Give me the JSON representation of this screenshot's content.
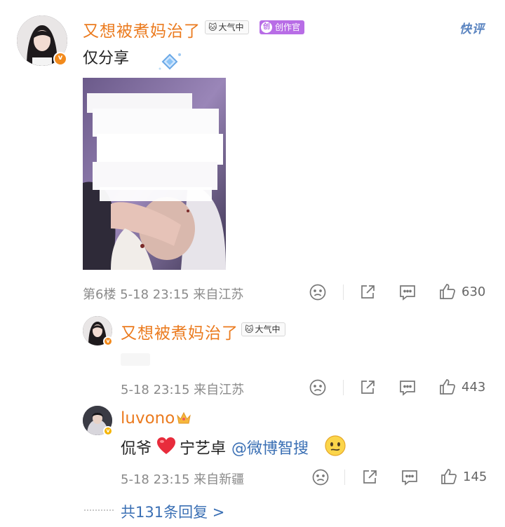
{
  "main_comment": {
    "username": "又想被煮妈治了",
    "tag_label": "大气中",
    "creator_label": "创作官",
    "quick_label": "快评",
    "text": "仅分享",
    "meta": "第6楼 5-18 23:15 来自江苏",
    "likes": "630"
  },
  "replies": [
    {
      "username": "又想被煮妈治了",
      "tag_label": "大气中",
      "meta": "5-18 23:15 来自江苏",
      "likes": "443"
    },
    {
      "username": "luvono",
      "text_prefix": "侃爷",
      "text_middle": "宁艺卓",
      "mention": "@微博智搜",
      "meta": "5-18 23:15 来自新疆",
      "likes": "145"
    }
  ],
  "footer": {
    "more_replies": "共131条回复 >"
  },
  "icons": {
    "verified_badge": "verified-badge-icon",
    "dislike": "dislike-face-icon",
    "share": "share-icon",
    "comment": "comment-icon",
    "like": "thumbs-up-icon"
  },
  "colors": {
    "username": "#eb7b1f",
    "link": "#3a6fb4",
    "meta": "#8a8a8a",
    "creator_badge": "#b86de6"
  }
}
